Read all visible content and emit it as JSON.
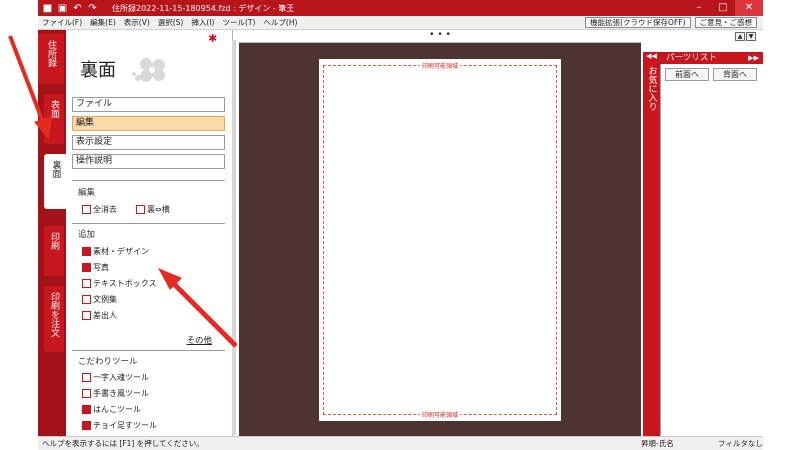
{
  "window": {
    "title": "住所録2022-11-15-180954.fzd : デザイン - 筆王",
    "icons": [
      "app-logo-icon",
      "save-icon",
      "undo-icon",
      "redo-icon"
    ],
    "controls": {
      "minimize": "–",
      "maximize": "□",
      "close": "✕"
    }
  },
  "menu": {
    "items": [
      "ファイル(F)",
      "編集(E)",
      "表示(V)",
      "選択(S)",
      "挿入(I)",
      "ツール(T)",
      "ヘルプ(H)"
    ],
    "right_buttons": [
      "機能拡張(クラウド保存OFF)",
      "ご意見・ご感想"
    ]
  },
  "tabs": {
    "address_book": "住所録",
    "front": "表面",
    "back": "裏面",
    "print": "印刷",
    "order_print": "印刷を注文"
  },
  "left_panel": {
    "title": "裏面",
    "menus": [
      "ファイル",
      "編集",
      "表示設定",
      "操作説明"
    ],
    "selected_menu": "編集",
    "edit_section": {
      "heading": "編集",
      "items": [
        "全消去",
        "裏⇔横"
      ]
    },
    "add_section": {
      "heading": "追加",
      "items": [
        "素材・デザイン",
        "写真",
        "テキストボックス",
        "文例集",
        "差出人"
      ],
      "more": "その他"
    },
    "tools_section": {
      "heading": "こだわりツール",
      "items": [
        "一字入魂ツール",
        "手書き風ツール",
        "はんこツール",
        "チョイ足すツール"
      ]
    }
  },
  "canvas": {
    "dots": "• • •",
    "print_area_label": "印刷可能領域"
  },
  "right_panel": {
    "favorites": "お気に入り",
    "parts_list": "パーツリスト",
    "front_btn": "前面へ",
    "back_btn": "背面へ"
  },
  "status": {
    "help": "ヘルプを表示するには [F1] を押してください。",
    "sort": "昇順-氏名",
    "filter": "フィルタなし"
  },
  "colors": {
    "accent": "#c8161e",
    "dark_accent": "#a31218",
    "selected": "#fbd9a8",
    "canvas_bg": "#4d3431"
  }
}
